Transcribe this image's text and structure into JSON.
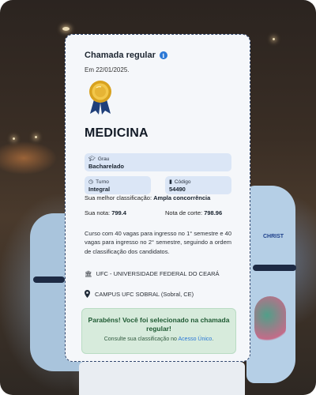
{
  "card": {
    "title": "Chamada regular",
    "date": "Em 22/01/2025.",
    "course": "MEDICINA",
    "grau_label": "Grau",
    "grau_value": "Bacharelado",
    "turno_label": "Turno",
    "turno_value": "Integral",
    "codigo_label": "Código",
    "codigo_value": "54490",
    "best_class_label": "Sua melhor classificação:",
    "best_class_value": "Ampla concorrência",
    "nota_label": "Sua nota:",
    "nota_value": "799.4",
    "corte_label": "Nota de corte:",
    "corte_value": "798.96",
    "description": "Curso com 40 vagas para ingresso no 1° semestre e 40 vagas para ingresso no 2° semestre, seguindo a ordem de classificação dos candidatos.",
    "institution": "UFC - UNIVERSIDADE FEDERAL DO CEARÁ",
    "campus": "CAMPUS UFC SOBRAL (Sobral, CE)",
    "success_title": "Parabéns! Você foi selecionado na chamada regular!",
    "success_sub_prefix": "Consulte sua classificação no",
    "success_link": "Acesso Único",
    "success_sub_suffix": "."
  },
  "background": {
    "shirt_print": "CHRIST"
  },
  "icons": {
    "info": "info-icon",
    "medal": "medal-icon",
    "grau": "graduation-cap-icon",
    "turno": "clock-icon",
    "codigo": "bookmark-icon",
    "institution": "bank-icon",
    "campus": "map-pin-icon"
  },
  "colors": {
    "accent": "#2b78d6",
    "chip": "#dbe6f6",
    "success_bg": "#d7ebdc",
    "success_text": "#1f5a33"
  }
}
